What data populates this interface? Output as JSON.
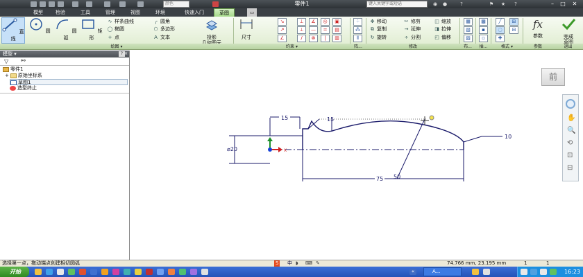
{
  "window": {
    "title": "零件1",
    "material_placeholder": "颜色",
    "search_placeholder": "键入关键字或短语"
  },
  "app": {
    "edition": "PRO"
  },
  "tabs": [
    "模型",
    "检验",
    "工具",
    "管理",
    "视图",
    "环境",
    "快速入门",
    "草图"
  ],
  "ribbon": {
    "draw": {
      "line": "直线",
      "circle": "圆",
      "arc": "圆弧",
      "rect": "矩形",
      "spline": "样条曲线",
      "ellipse": "椭圆",
      "point": "点",
      "fillet": "圆角",
      "polygon": "多边形",
      "text": "文本",
      "project": "投影",
      "geometry": "几何图元",
      "group": "绘图"
    },
    "constrain": {
      "dimension": "尺寸",
      "group": "约束"
    },
    "pattern": {
      "group": "阵..."
    },
    "modify": {
      "move": "移动",
      "copy": "复制",
      "rotate": "旋转",
      "trim": "修剪",
      "extend": "延伸",
      "split": "分割",
      "scale": "缩放",
      "stretch": "拉伸",
      "offset": "偏移",
      "group": "修改"
    },
    "layout": {
      "group": "布..."
    },
    "insert": {
      "group": "插..."
    },
    "format": {
      "group": "格式"
    },
    "params": {
      "label": "参数",
      "group": "参数"
    },
    "exit": {
      "label": "完成草图",
      "group": "退出"
    }
  },
  "browser": {
    "header": "模型",
    "tree": [
      {
        "label": "零件1"
      },
      {
        "label": "原始坐标系"
      },
      {
        "label": "草图1"
      },
      {
        "label": "造型终止"
      }
    ]
  },
  "drawing": {
    "dims": [
      "15",
      "15",
      "20",
      "10",
      "75",
      "50"
    ],
    "axis_label": "X"
  },
  "viewcube": {
    "label": "前"
  },
  "status": {
    "message": "选择第一点，拖动端点创建相切圆弧",
    "coords": "74.766 mm, 23.195 mm",
    "v1": "1",
    "v2": "1"
  },
  "taskbar": {
    "start": "开始",
    "task": "A...",
    "clock": "16:23"
  }
}
